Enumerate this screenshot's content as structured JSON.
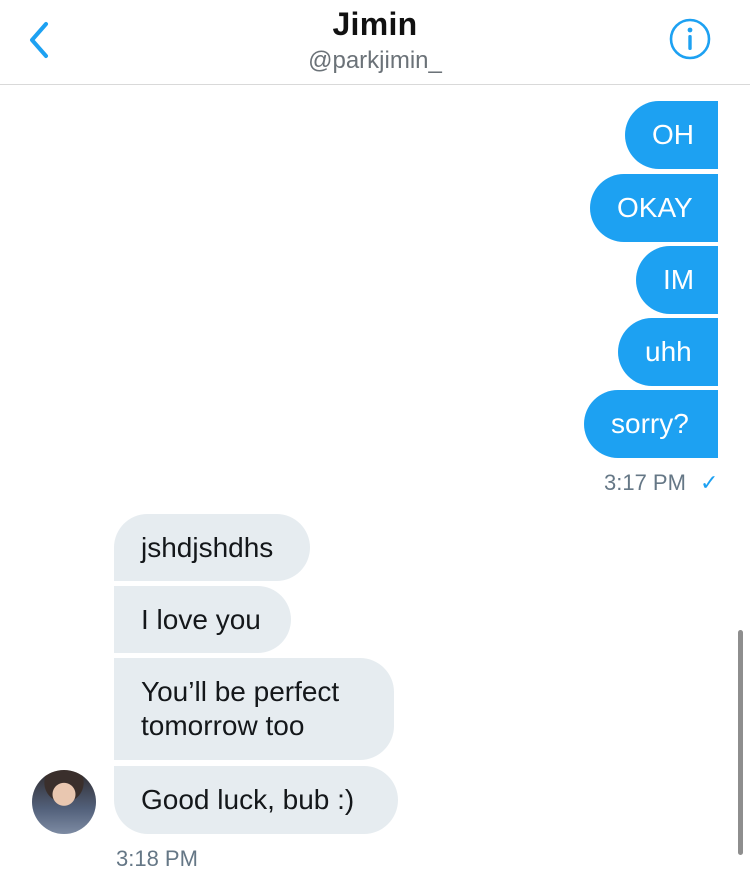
{
  "header": {
    "title": "Jimin",
    "handle": "@parkjimin_"
  },
  "sent_messages": [
    "OH",
    "OKAY",
    "IM",
    "uhh",
    "sorry?"
  ],
  "sent_time": "3:17 PM",
  "sent_status": "✓",
  "received_messages": [
    "jshdjshdhs",
    "I love you",
    "You’ll be perfect tomorrow too",
    "Good luck, bub :)"
  ],
  "received_time": "3:18 PM",
  "colors": {
    "accent": "#1da1f2",
    "received_bubble": "#e6ecf0",
    "timestamp": "#657786"
  },
  "icons": {
    "back": "chevron-left-icon",
    "info": "info-circle-icon",
    "delivered": "checkmark-icon"
  }
}
